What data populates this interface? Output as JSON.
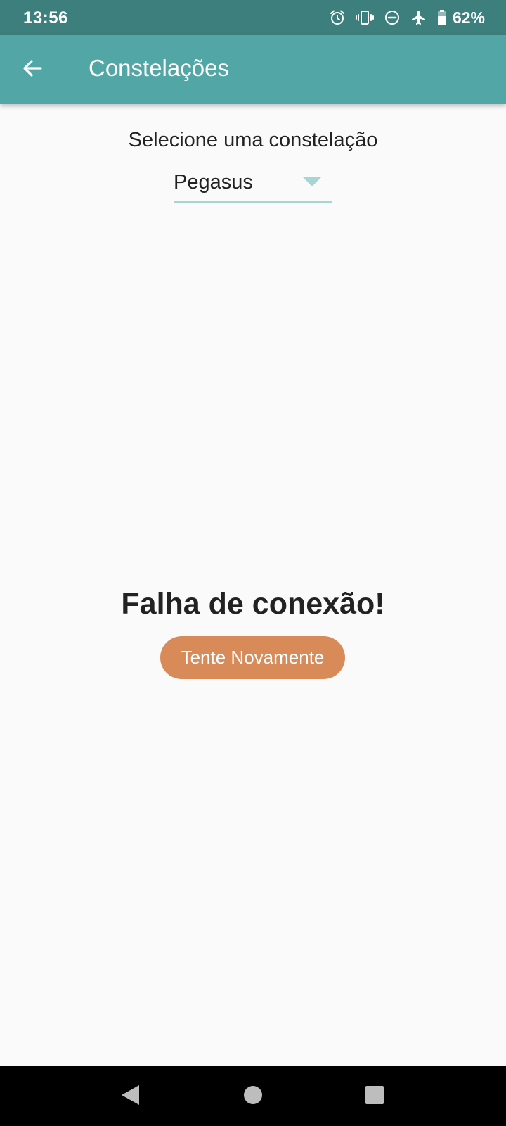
{
  "status_bar": {
    "time": "13:56",
    "icons": [
      "alarm-icon",
      "vibrate-icon",
      "do-not-disturb-icon",
      "airplane-mode-icon",
      "battery-icon"
    ],
    "battery_percent": "62%"
  },
  "app_bar": {
    "title": "Constelações",
    "back_icon": "arrow-back-icon",
    "background_color": "#52a7a6"
  },
  "selector": {
    "label": "Selecione uma constelação",
    "selected_value": "Pegasus",
    "arrow_icon": "dropdown-arrow-icon",
    "underline_color": "#a7d5d4"
  },
  "error": {
    "title": "Falha de conexão!",
    "retry_label": "Tente Novamente",
    "retry_color": "#d88a58"
  },
  "nav_bar": {
    "icons": [
      "nav-back-icon",
      "nav-home-icon",
      "nav-recents-icon"
    ]
  }
}
